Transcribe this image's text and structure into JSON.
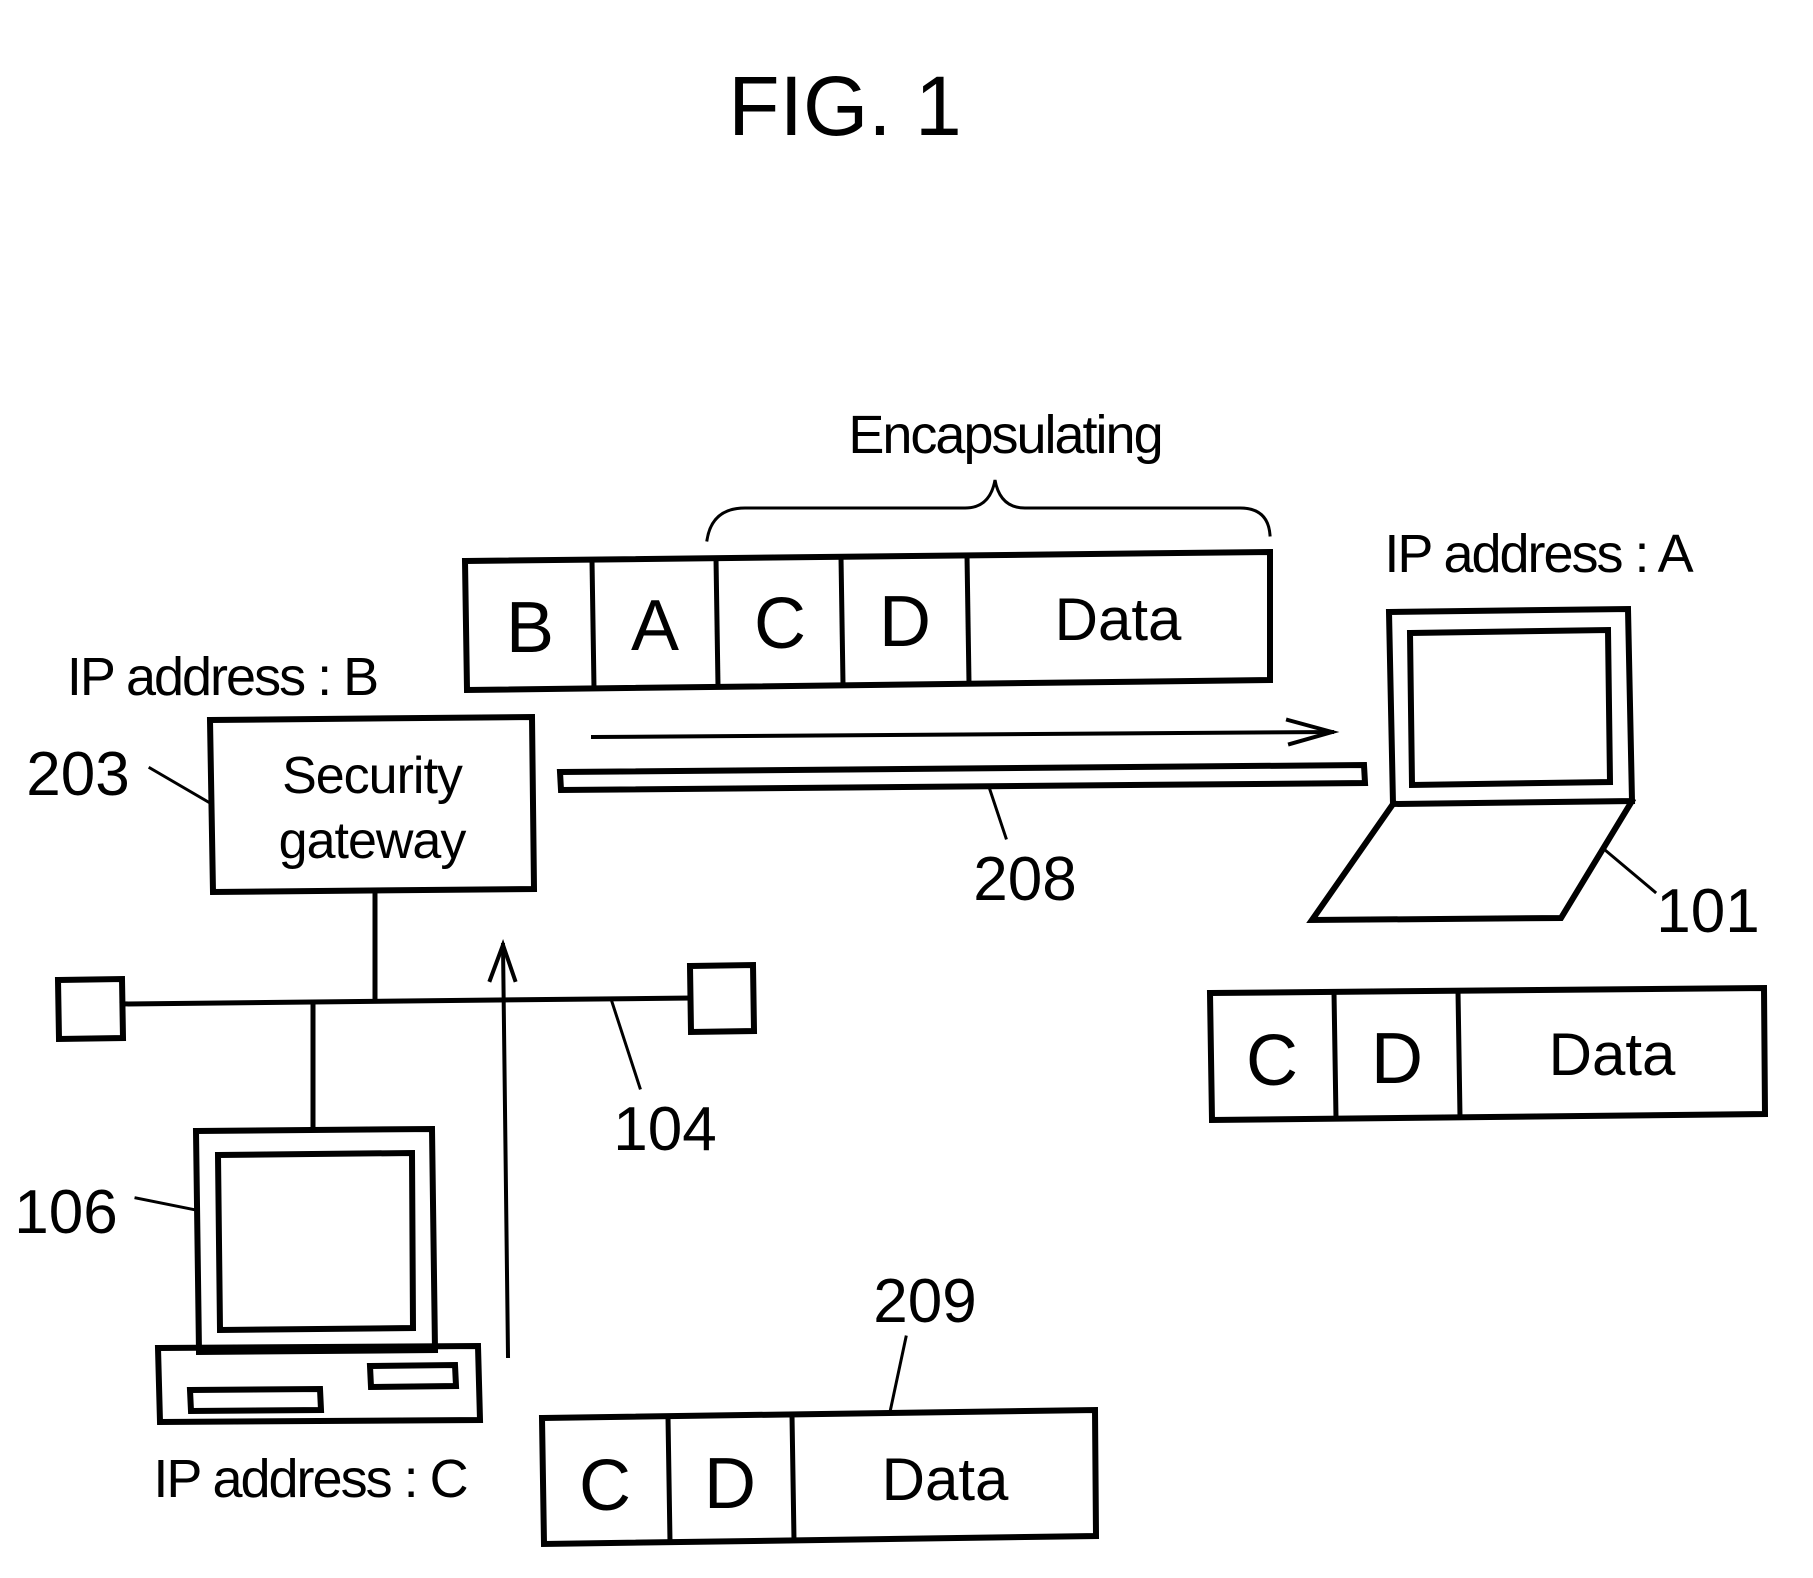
{
  "figure": {
    "title": "FIG. 1",
    "colors": {
      "ink": "#000000",
      "background": "#ffffff"
    }
  },
  "encapsulation": {
    "label": "Encapsulating",
    "packet_cells": [
      "B",
      "A",
      "C",
      "D",
      "Data"
    ]
  },
  "gateway": {
    "ref": "203",
    "line1": "Security",
    "line2": "gateway",
    "ip_label": "IP address : B"
  },
  "tunnel": {
    "ref": "208"
  },
  "laptop": {
    "ref": "101",
    "ip_label": "IP address : A",
    "packet_cells": [
      "C",
      "D",
      "Data"
    ]
  },
  "lan": {
    "ref": "104"
  },
  "desktop": {
    "ref": "106",
    "ip_label": "IP address : C"
  },
  "original_packet": {
    "ref": "209",
    "packet_cells": [
      "C",
      "D",
      "Data"
    ]
  }
}
